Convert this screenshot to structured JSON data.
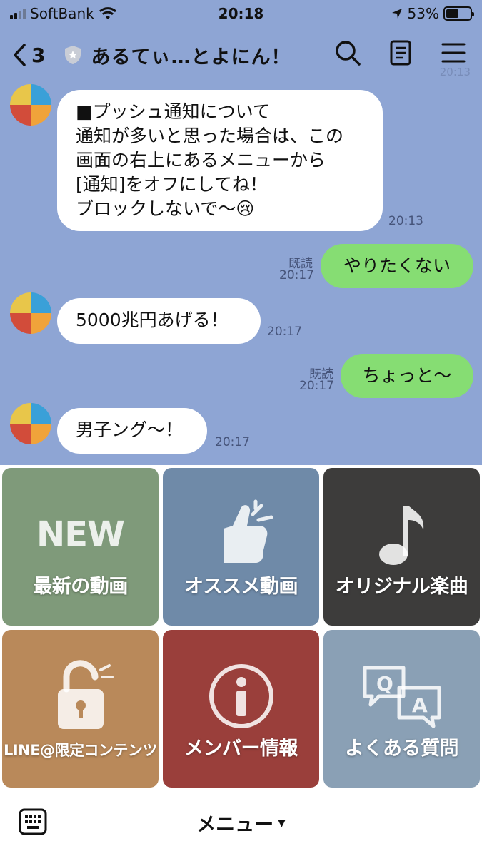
{
  "status_bar": {
    "carrier": "SoftBank",
    "time": "20:18",
    "battery": "53%",
    "battery_level": 0.53
  },
  "header": {
    "unread_count": "3",
    "title": "あるてぃ…とよにん！"
  },
  "ghost_time": "20:13",
  "messages": [
    {
      "lines": [
        "■プッシュ通知について",
        "通知が多いと思った場合は、この",
        "画面の右上にあるメニューから",
        "[通知]をオフにしてね！",
        "ブロックしないで〜😢"
      ],
      "time": "20:13"
    },
    {
      "text": "やりたくない",
      "read": "既読",
      "time": "20:17"
    },
    {
      "text": "5000兆円あげる！",
      "time": "20:17"
    },
    {
      "text": "ちょっと〜",
      "read": "既読",
      "time": "20:17"
    },
    {
      "text": "男子ング〜！",
      "time": "20:17"
    }
  ],
  "rich_menu": [
    {
      "label": "最新の動画",
      "badge": "NEW",
      "color": "#7f9a7a"
    },
    {
      "label": "オススメ動画",
      "color": "#6f8aa8"
    },
    {
      "label": "オリジナル楽曲",
      "color": "#3d3c3b"
    },
    {
      "label": "LINE@限定コンテンツ",
      "color": "#b9895a"
    },
    {
      "label": "メンバー情報",
      "color": "#9a3f3b"
    },
    {
      "label": "よくある質問",
      "color": "#8aa0b5"
    }
  ],
  "bottom_bar": {
    "menu_label": "メニュー",
    "caret": "▼"
  },
  "colors": {
    "chat_bg": "#8ea5d4",
    "my_bubble": "#86dd73",
    "their_bubble": "#ffffff"
  }
}
